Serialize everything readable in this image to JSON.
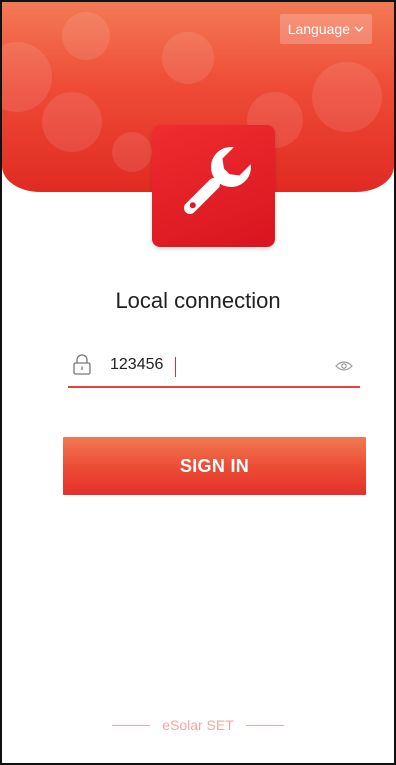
{
  "header": {
    "language_label": "Language",
    "language_icon": "chevron-down-icon",
    "background_icon": "wrench-watermark"
  },
  "app_icon": {
    "icon": "wrench-icon"
  },
  "title": "Local connection",
  "password_field": {
    "value": "123456",
    "lock_icon": "lock-icon",
    "visibility_icon": "eye-icon"
  },
  "signin_label": "SIGN IN",
  "footer_label": "eSolar SET",
  "colors": {
    "accent": "#e8382b",
    "accent_light": "#f37a55",
    "footer_text": "#f0a8a1"
  }
}
